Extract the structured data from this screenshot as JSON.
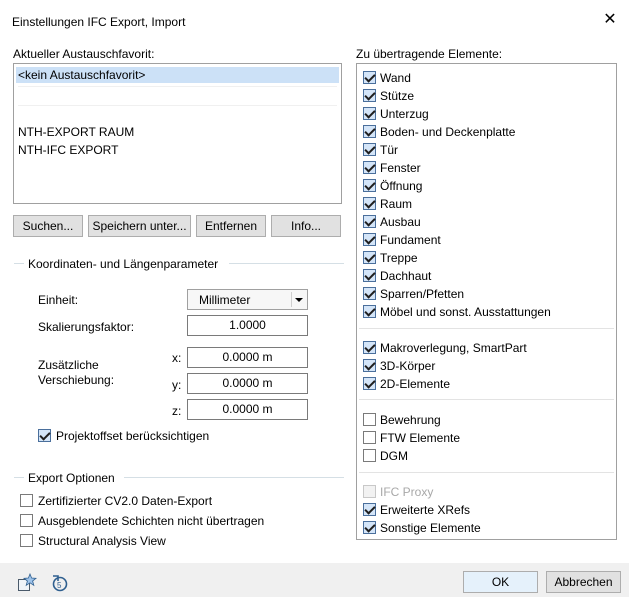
{
  "window": {
    "title": "Einstellungen IFC Export, Import",
    "close_glyph": "✕"
  },
  "favorites": {
    "label": "Aktueller Austauschfavorit:",
    "items": [
      "<kein Austauschfavorit>",
      "NTH-EXPORT RAUM",
      "NTH-IFC EXPORT"
    ],
    "selected": "<kein Austauschfavorit>",
    "buttons": [
      "Suchen...",
      "Speichern unter...",
      "Entfernen",
      "Info..."
    ]
  },
  "coordinates": {
    "group_label": "Koordinaten- und Längenparameter",
    "unit_label": "Einheit:",
    "unit_value": "Millimeter",
    "scale_label": "Skalierungsfaktor:",
    "scale_value": "1.0000",
    "offset_label_line1": "Zusätzliche",
    "offset_label_line2": "Verschiebung:",
    "x_label": "x:",
    "x_value": "0.0000 m",
    "y_label": "y:",
    "y_value": "0.0000 m",
    "z_label": "z:",
    "z_value": "0.0000 m",
    "project_offset": {
      "label": "Projektoffset berücksichtigen",
      "checked": true
    }
  },
  "export_options": {
    "group_label": "Export Optionen",
    "items": [
      {
        "label": "Zertifizierter CV2.0 Daten-Export",
        "checked": false
      },
      {
        "label": "Ausgeblendete Schichten nicht übertragen",
        "checked": false
      },
      {
        "label": "Structural Analysis View",
        "checked": false
      }
    ]
  },
  "elements": {
    "label": "Zu übertragende Elemente:",
    "groups": [
      [
        {
          "label": "Wand",
          "checked": true
        },
        {
          "label": "Stütze",
          "checked": true
        },
        {
          "label": "Unterzug",
          "checked": true
        },
        {
          "label": "Boden- und Deckenplatte",
          "checked": true
        },
        {
          "label": "Tür",
          "checked": true
        },
        {
          "label": "Fenster",
          "checked": true
        },
        {
          "label": "Öffnung",
          "checked": true
        },
        {
          "label": "Raum",
          "checked": true
        },
        {
          "label": "Ausbau",
          "checked": true
        },
        {
          "label": "Fundament",
          "checked": true
        },
        {
          "label": "Treppe",
          "checked": true
        },
        {
          "label": "Dachhaut",
          "checked": true
        },
        {
          "label": "Sparren/Pfetten",
          "checked": true
        },
        {
          "label": "Möbel und sonst. Ausstattungen",
          "checked": true
        }
      ],
      [
        {
          "label": "Makroverlegung, SmartPart",
          "checked": true
        },
        {
          "label": "3D-Körper",
          "checked": true
        },
        {
          "label": "2D-Elemente",
          "checked": true
        }
      ],
      [
        {
          "label": "Bewehrung",
          "checked": false
        },
        {
          "label": "FTW Elemente",
          "checked": false
        },
        {
          "label": "DGM",
          "checked": false
        }
      ],
      [
        {
          "label": "IFC Proxy",
          "checked": false,
          "disabled": true
        },
        {
          "label": "Erweiterte XRefs",
          "checked": true
        },
        {
          "label": "Sonstige Elemente",
          "checked": true
        }
      ]
    ]
  },
  "footer": {
    "ok_label": "OK",
    "cancel_label": "Abbrechen",
    "icons": [
      "favorite-star-icon",
      "reset-undo-icon"
    ]
  }
}
